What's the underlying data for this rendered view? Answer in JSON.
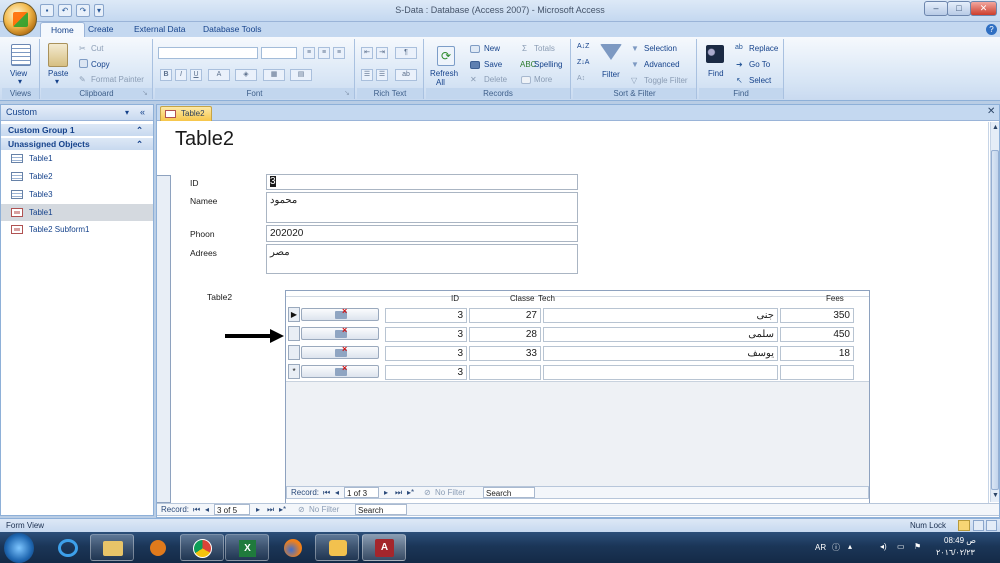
{
  "app": {
    "title": "S-Data : Database (Access 2007) - Microsoft Access"
  },
  "ribbon_tabs": [
    "Home",
    "Create",
    "External Data",
    "Database Tools"
  ],
  "ribbon": {
    "views": {
      "view": "View",
      "label": "Views"
    },
    "clipboard": {
      "paste": "Paste",
      "cut": "Cut",
      "copy": "Copy",
      "format_painter": "Format Painter",
      "label": "Clipboard"
    },
    "font": {
      "label": "Font"
    },
    "rich_text": {
      "label": "Rich Text"
    },
    "records": {
      "refresh": "Refresh",
      "refresh_sub": "All",
      "new": "New",
      "save": "Save",
      "delete": "Delete",
      "totals": "Totals",
      "spelling": "Spelling",
      "more": "More",
      "label": "Records"
    },
    "sort_filter": {
      "filter": "Filter",
      "selection": "Selection",
      "advanced": "Advanced",
      "toggle_filter": "Toggle Filter",
      "label": "Sort & Filter"
    },
    "find": {
      "find": "Find",
      "replace": "Replace",
      "goto": "Go To",
      "select": "Select",
      "label": "Find"
    }
  },
  "nav": {
    "header": "Custom",
    "groups": [
      "Custom Group 1",
      "Unassigned Objects"
    ],
    "items": [
      {
        "label": "Table1",
        "type": "table"
      },
      {
        "label": "Table2",
        "type": "table"
      },
      {
        "label": "Table3",
        "type": "table"
      },
      {
        "label": "Table1",
        "type": "form"
      },
      {
        "label": "Table2 Subform1",
        "type": "form"
      }
    ]
  },
  "doc": {
    "tab": "Table2",
    "form_title": "Table2",
    "fields": [
      {
        "label": "ID",
        "value": "3"
      },
      {
        "label": "Namee",
        "value": "محمود"
      },
      {
        "label": "Phoon",
        "value": "202020"
      },
      {
        "label": "Adrees",
        "value": "مصر"
      }
    ],
    "subform": {
      "label": "Table2",
      "columns": [
        "ID",
        "Classe",
        "Tech",
        "Fees"
      ],
      "rows": [
        {
          "id": "3",
          "classe": "27",
          "tech": "جنى",
          "fees": "350"
        },
        {
          "id": "3",
          "classe": "28",
          "tech": "سلمى",
          "fees": "450"
        },
        {
          "id": "3",
          "classe": "33",
          "tech": "يوسف",
          "fees": "18"
        },
        {
          "id": "3",
          "classe": "",
          "tech": "",
          "fees": ""
        }
      ],
      "nav": {
        "record_label": "Record:",
        "position": "1 of 3",
        "filter": "No Filter",
        "search": "Search"
      }
    },
    "nav": {
      "record_label": "Record:",
      "position": "3 of 5",
      "filter": "No Filter",
      "search": "Search"
    }
  },
  "status": {
    "left": "Form View",
    "numlock": "Num Lock"
  },
  "taskbar": {
    "lang": "AR",
    "time": "08:49 ص",
    "date": "٢٠١٦/٠٢/٢٣"
  }
}
